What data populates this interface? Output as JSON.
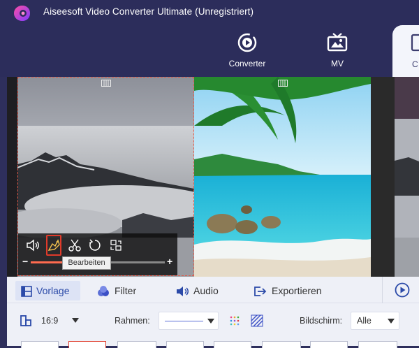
{
  "app": {
    "title": "Aiseesoft Video Converter Ultimate (Unregistriert)"
  },
  "nav": {
    "items": [
      {
        "label": "Converter",
        "icon": "converter-icon"
      },
      {
        "label": "MV",
        "icon": "mv-icon"
      },
      {
        "label": "C",
        "icon": "collage-icon",
        "active": true
      }
    ]
  },
  "toolbar": {
    "tooltip": "Bearbeiten",
    "volume_minus": "−",
    "volume_plus": "+",
    "volume_level": 0.24
  },
  "tabs": [
    {
      "label": "Vorlage",
      "icon": "template-icon",
      "active": true
    },
    {
      "label": "Filter",
      "icon": "filter-icon"
    },
    {
      "label": "Audio",
      "icon": "audio-icon"
    },
    {
      "label": "Exportieren",
      "icon": "export-icon"
    }
  ],
  "controls": {
    "aspect": "16:9",
    "rahmen_label": "Rahmen:",
    "bildschirm_label": "Bildschirm:",
    "bildschirm_value": "Alle"
  },
  "colors": {
    "accent": "#e03a2a",
    "header": "#2c2d5b",
    "active_tab": "#2b4aa8"
  }
}
